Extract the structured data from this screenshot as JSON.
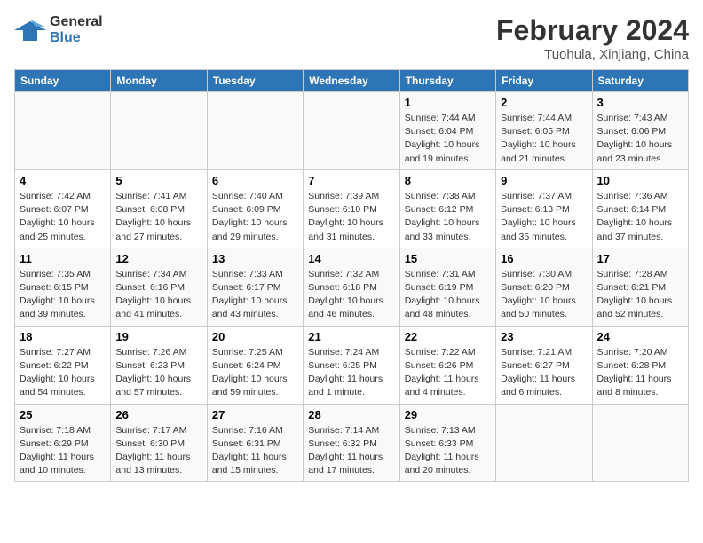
{
  "header": {
    "logo_line1": "General",
    "logo_line2": "Blue",
    "main_title": "February 2024",
    "sub_title": "Tuohula, Xinjiang, China"
  },
  "columns": [
    "Sunday",
    "Monday",
    "Tuesday",
    "Wednesday",
    "Thursday",
    "Friday",
    "Saturday"
  ],
  "weeks": [
    {
      "days": [
        {
          "num": "",
          "info": ""
        },
        {
          "num": "",
          "info": ""
        },
        {
          "num": "",
          "info": ""
        },
        {
          "num": "",
          "info": ""
        },
        {
          "num": "1",
          "info": "Sunrise: 7:44 AM\nSunset: 6:04 PM\nDaylight: 10 hours\nand 19 minutes."
        },
        {
          "num": "2",
          "info": "Sunrise: 7:44 AM\nSunset: 6:05 PM\nDaylight: 10 hours\nand 21 minutes."
        },
        {
          "num": "3",
          "info": "Sunrise: 7:43 AM\nSunset: 6:06 PM\nDaylight: 10 hours\nand 23 minutes."
        }
      ]
    },
    {
      "days": [
        {
          "num": "4",
          "info": "Sunrise: 7:42 AM\nSunset: 6:07 PM\nDaylight: 10 hours\nand 25 minutes."
        },
        {
          "num": "5",
          "info": "Sunrise: 7:41 AM\nSunset: 6:08 PM\nDaylight: 10 hours\nand 27 minutes."
        },
        {
          "num": "6",
          "info": "Sunrise: 7:40 AM\nSunset: 6:09 PM\nDaylight: 10 hours\nand 29 minutes."
        },
        {
          "num": "7",
          "info": "Sunrise: 7:39 AM\nSunset: 6:10 PM\nDaylight: 10 hours\nand 31 minutes."
        },
        {
          "num": "8",
          "info": "Sunrise: 7:38 AM\nSunset: 6:12 PM\nDaylight: 10 hours\nand 33 minutes."
        },
        {
          "num": "9",
          "info": "Sunrise: 7:37 AM\nSunset: 6:13 PM\nDaylight: 10 hours\nand 35 minutes."
        },
        {
          "num": "10",
          "info": "Sunrise: 7:36 AM\nSunset: 6:14 PM\nDaylight: 10 hours\nand 37 minutes."
        }
      ]
    },
    {
      "days": [
        {
          "num": "11",
          "info": "Sunrise: 7:35 AM\nSunset: 6:15 PM\nDaylight: 10 hours\nand 39 minutes."
        },
        {
          "num": "12",
          "info": "Sunrise: 7:34 AM\nSunset: 6:16 PM\nDaylight: 10 hours\nand 41 minutes."
        },
        {
          "num": "13",
          "info": "Sunrise: 7:33 AM\nSunset: 6:17 PM\nDaylight: 10 hours\nand 43 minutes."
        },
        {
          "num": "14",
          "info": "Sunrise: 7:32 AM\nSunset: 6:18 PM\nDaylight: 10 hours\nand 46 minutes."
        },
        {
          "num": "15",
          "info": "Sunrise: 7:31 AM\nSunset: 6:19 PM\nDaylight: 10 hours\nand 48 minutes."
        },
        {
          "num": "16",
          "info": "Sunrise: 7:30 AM\nSunset: 6:20 PM\nDaylight: 10 hours\nand 50 minutes."
        },
        {
          "num": "17",
          "info": "Sunrise: 7:28 AM\nSunset: 6:21 PM\nDaylight: 10 hours\nand 52 minutes."
        }
      ]
    },
    {
      "days": [
        {
          "num": "18",
          "info": "Sunrise: 7:27 AM\nSunset: 6:22 PM\nDaylight: 10 hours\nand 54 minutes."
        },
        {
          "num": "19",
          "info": "Sunrise: 7:26 AM\nSunset: 6:23 PM\nDaylight: 10 hours\nand 57 minutes."
        },
        {
          "num": "20",
          "info": "Sunrise: 7:25 AM\nSunset: 6:24 PM\nDaylight: 10 hours\nand 59 minutes."
        },
        {
          "num": "21",
          "info": "Sunrise: 7:24 AM\nSunset: 6:25 PM\nDaylight: 11 hours\nand 1 minute."
        },
        {
          "num": "22",
          "info": "Sunrise: 7:22 AM\nSunset: 6:26 PM\nDaylight: 11 hours\nand 4 minutes."
        },
        {
          "num": "23",
          "info": "Sunrise: 7:21 AM\nSunset: 6:27 PM\nDaylight: 11 hours\nand 6 minutes."
        },
        {
          "num": "24",
          "info": "Sunrise: 7:20 AM\nSunset: 6:28 PM\nDaylight: 11 hours\nand 8 minutes."
        }
      ]
    },
    {
      "days": [
        {
          "num": "25",
          "info": "Sunrise: 7:18 AM\nSunset: 6:29 PM\nDaylight: 11 hours\nand 10 minutes."
        },
        {
          "num": "26",
          "info": "Sunrise: 7:17 AM\nSunset: 6:30 PM\nDaylight: 11 hours\nand 13 minutes."
        },
        {
          "num": "27",
          "info": "Sunrise: 7:16 AM\nSunset: 6:31 PM\nDaylight: 11 hours\nand 15 minutes."
        },
        {
          "num": "28",
          "info": "Sunrise: 7:14 AM\nSunset: 6:32 PM\nDaylight: 11 hours\nand 17 minutes."
        },
        {
          "num": "29",
          "info": "Sunrise: 7:13 AM\nSunset: 6:33 PM\nDaylight: 11 hours\nand 20 minutes."
        },
        {
          "num": "",
          "info": ""
        },
        {
          "num": "",
          "info": ""
        }
      ]
    }
  ]
}
